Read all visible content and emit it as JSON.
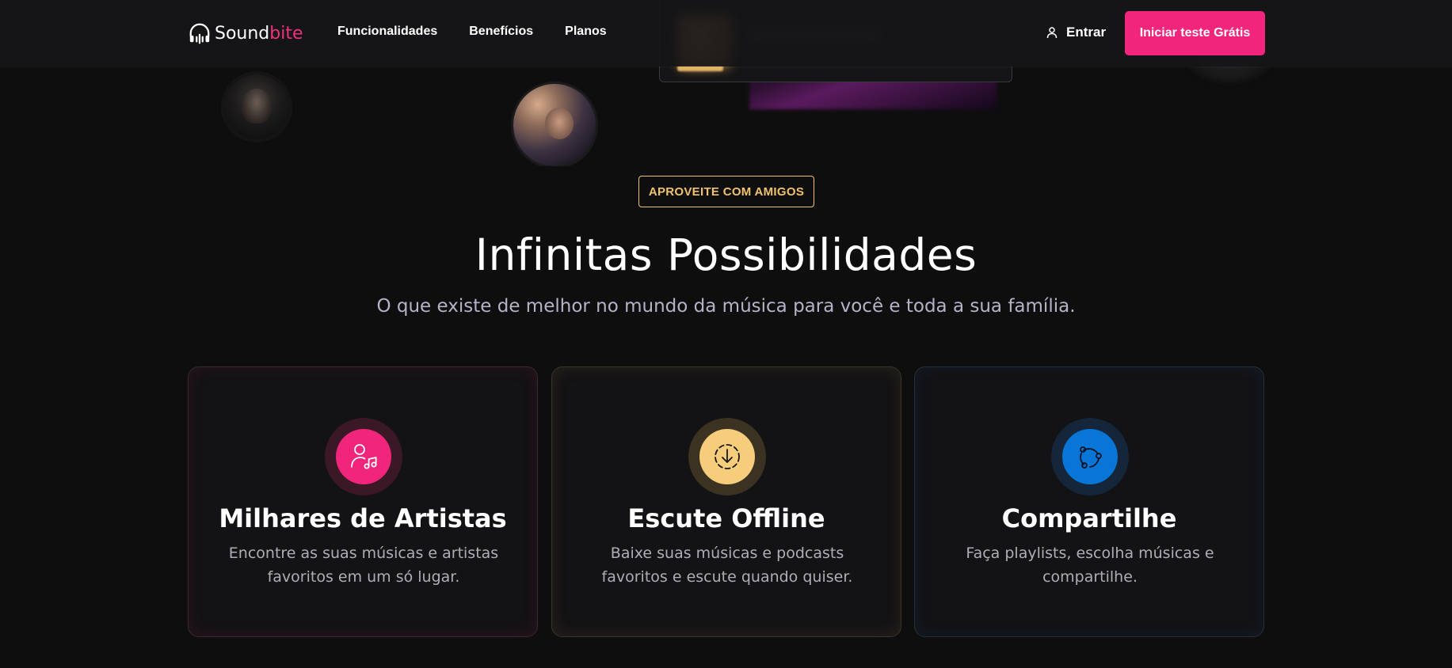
{
  "brand": {
    "name_part1": "Sound",
    "name_part2": "bite",
    "accent_color": "#f0317f"
  },
  "nav": {
    "items": [
      {
        "label": "Funcionalidades"
      },
      {
        "label": "Benefícios"
      },
      {
        "label": "Planos"
      }
    ]
  },
  "header_actions": {
    "login_label": "Entrar",
    "login_icon": "user-icon",
    "cta_label": "Iniciar teste Grátis",
    "cta_color": "#f0257b"
  },
  "section": {
    "tag": "APROVEITE COM AMIGOS",
    "tag_color": "#f0c36a",
    "title": "Infinitas Possibilidades",
    "subtitle": "O que existe de melhor no mundo da música para você e toda a sua família."
  },
  "features": [
    {
      "icon": "artist-music-icon",
      "color": "#f0257b",
      "title": "Milhares de Artistas",
      "text": "Encontre as suas músicas e artistas favoritos em um só lugar."
    },
    {
      "icon": "download-offline-icon",
      "color": "#f6cd7a",
      "title": "Escute Offline",
      "text": "Baixe suas músicas e podcasts favoritos e escute quando quiser."
    },
    {
      "icon": "share-icon",
      "color": "#0876d6",
      "title": "Compartilhe",
      "text": "Faça playlists, escolha músicas e compartilhe."
    }
  ]
}
